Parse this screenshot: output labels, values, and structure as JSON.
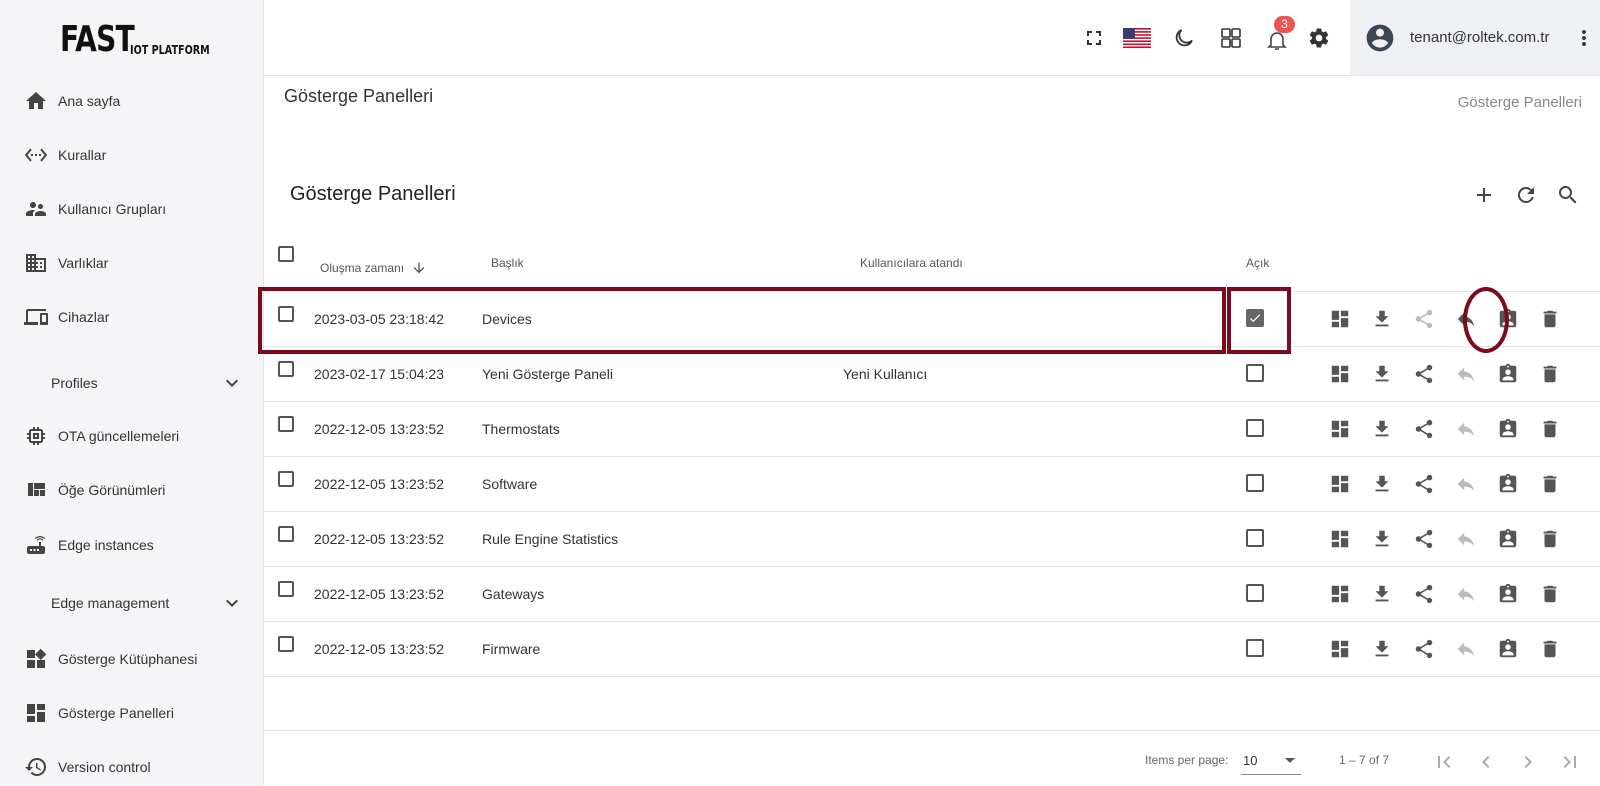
{
  "logo": {
    "main": "FAST",
    "sub": "IOT PLATFORM"
  },
  "sidebar": {
    "items": [
      {
        "label": "Ana sayfa",
        "icon": "home-icon"
      },
      {
        "label": "Kurallar",
        "icon": "settings-ethernet-icon"
      },
      {
        "label": "Kullanıcı Grupları",
        "icon": "supervisor-account-icon"
      },
      {
        "label": "Varlıklar",
        "icon": "domain-icon"
      },
      {
        "label": "Cihazlar",
        "icon": "devices-icon"
      },
      {
        "label": "Profiles",
        "icon": "chevron-down-icon"
      },
      {
        "label": "OTA güncellemeleri",
        "icon": "memory-chip-icon"
      },
      {
        "label": "Öğe Görünümleri",
        "icon": "view-quilt-icon"
      },
      {
        "label": "Edge instances",
        "icon": "router-icon"
      },
      {
        "label": "Edge management",
        "icon": "chevron-down-icon"
      },
      {
        "label": "Gösterge Kütüphanesi",
        "icon": "widgets-icon"
      },
      {
        "label": "Gösterge Panelleri",
        "icon": "dashboard-icon"
      },
      {
        "label": "Version control",
        "icon": "history-icon"
      }
    ]
  },
  "header": {
    "notification_count": "3",
    "user_email": "tenant@roltek.com.tr",
    "icons": [
      "fullscreen-icon",
      "us-flag-icon",
      "dark-mode-icon",
      "apps-icon",
      "notifications-icon",
      "settings-icon",
      "account-circle-icon",
      "more-vert-icon"
    ]
  },
  "page": {
    "title": "Gösterge Panelleri",
    "breadcrumb": "Gösterge Panelleri",
    "card_title": "Gösterge Panelleri"
  },
  "table": {
    "columns": {
      "created": "Oluşma zamanı",
      "title": "Başlık",
      "assigned": "Kullanıcılara atandı",
      "public": "Açık"
    },
    "rows": [
      {
        "created": "2023-03-05 23:18:42",
        "title": "Devices",
        "assigned": "",
        "public": true
      },
      {
        "created": "2023-02-17 15:04:23",
        "title": "Yeni Gösterge Paneli",
        "assigned": "Yeni Kullanıcı",
        "public": false
      },
      {
        "created": "2022-12-05 13:23:52",
        "title": "Thermostats",
        "assigned": "",
        "public": false
      },
      {
        "created": "2022-12-05 13:23:52",
        "title": "Software",
        "assigned": "",
        "public": false
      },
      {
        "created": "2022-12-05 13:23:52",
        "title": "Rule Engine Statistics",
        "assigned": "",
        "public": false
      },
      {
        "created": "2022-12-05 13:23:52",
        "title": "Gateways",
        "assigned": "",
        "public": false
      },
      {
        "created": "2022-12-05 13:23:52",
        "title": "Firmware",
        "assigned": "",
        "public": false
      }
    ],
    "row_actions": [
      "open-dashboard-icon",
      "export-icon",
      "share-icon",
      "make-private-icon",
      "assign-customers-icon",
      "delete-icon"
    ]
  },
  "paginator": {
    "items_per_page_label": "Items per page:",
    "items_per_page": "10",
    "range": "1 – 7 of 7"
  },
  "colors": {
    "highlight": "#7a0a1e",
    "badge": "#f25252",
    "icon": "#555555"
  }
}
